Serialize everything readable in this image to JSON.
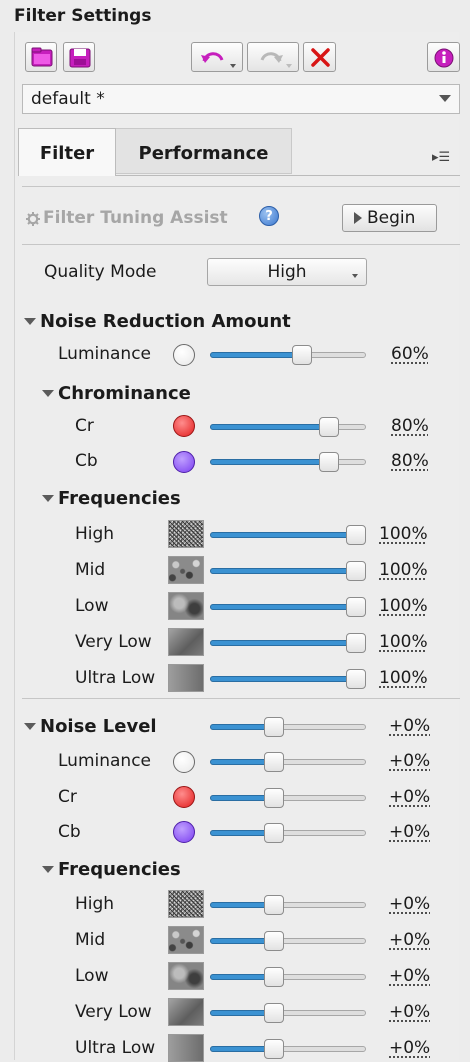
{
  "panel": {
    "title": "Filter Settings"
  },
  "toolbar": {
    "open_icon": "folder-icon",
    "save_icon": "floppy-disk-icon",
    "undo_icon": "undo-icon",
    "redo_icon": "redo-icon",
    "reset_icon": "close-x-icon",
    "info_icon": "info-icon"
  },
  "preset": {
    "value": "default *"
  },
  "tabs": {
    "filter": "Filter",
    "performance": "Performance",
    "menu_glyph": "▸☰"
  },
  "assist": {
    "label": "Filter Tuning Assist",
    "help_glyph": "?",
    "button": "Begin"
  },
  "quality": {
    "label": "Quality Mode",
    "value": "High"
  },
  "noise_reduction": {
    "header": "Noise Reduction Amount",
    "luminance": {
      "label": "Luminance",
      "value": "60%",
      "level": 0.6
    },
    "chrominance": {
      "header": "Chrominance",
      "cr": {
        "label": "Cr",
        "value": "80%",
        "level": 0.8,
        "color": "#e21e1e"
      },
      "cb": {
        "label": "Cb",
        "value": "80%",
        "level": 0.8,
        "color": "#7b3ff0"
      }
    },
    "frequencies": {
      "header": "Frequencies",
      "rows": [
        {
          "label": "High",
          "value": "100%",
          "level": 1.0
        },
        {
          "label": "Mid",
          "value": "100%",
          "level": 1.0
        },
        {
          "label": "Low",
          "value": "100%",
          "level": 1.0
        },
        {
          "label": "Very Low",
          "value": "100%",
          "level": 1.0
        },
        {
          "label": "Ultra Low",
          "value": "100%",
          "level": 1.0
        }
      ]
    }
  },
  "noise_level": {
    "header": "Noise Level",
    "header_value": "+0%",
    "header_level": 0.4,
    "luminance": {
      "label": "Luminance",
      "value": "+0%",
      "level": 0.4
    },
    "cr": {
      "label": "Cr",
      "value": "+0%",
      "level": 0.4
    },
    "cb": {
      "label": "Cb",
      "value": "+0%",
      "level": 0.4
    },
    "frequencies": {
      "header": "Frequencies",
      "rows": [
        {
          "label": "High",
          "value": "+0%",
          "level": 0.4
        },
        {
          "label": "Mid",
          "value": "+0%",
          "level": 0.4
        },
        {
          "label": "Low",
          "value": "+0%",
          "level": 0.4
        },
        {
          "label": "Very Low",
          "value": "+0%",
          "level": 0.4
        },
        {
          "label": "Ultra Low",
          "value": "+0%",
          "level": 0.4
        }
      ]
    }
  },
  "colors": {
    "accent": "#3b92d2",
    "red": "#e21e1e",
    "purple": "#7b3ff0",
    "assist_disabled": "#a6a6a6"
  }
}
